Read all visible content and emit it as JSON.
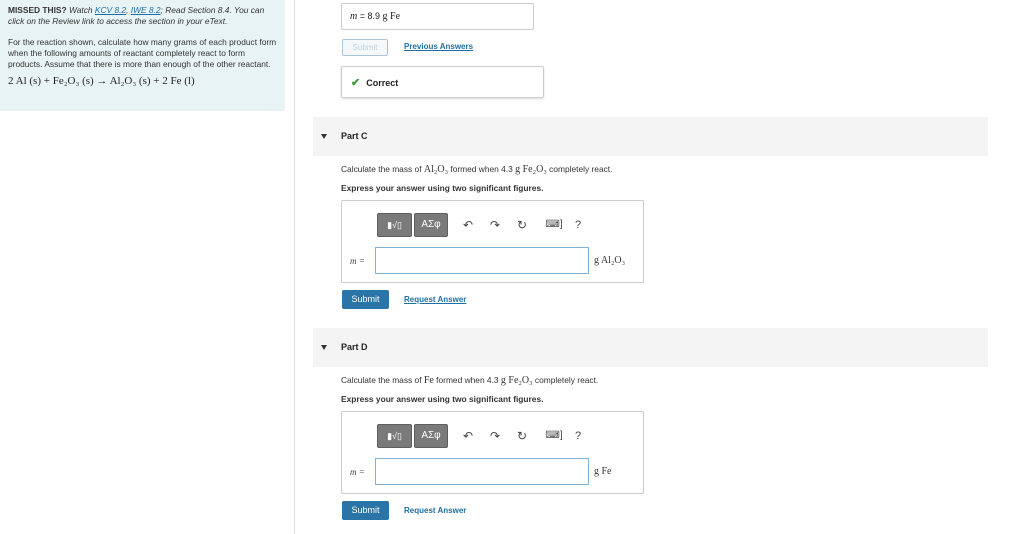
{
  "left": {
    "missed_label": "MISSED THIS?",
    "watch_text": "Watch",
    "link1": "KCV 8.2",
    "sep": ",",
    "link2": "IWE 8.2",
    "read_text": "; Read Section 8.4. You can click on the Review link to access the section in your eText.",
    "instructions": "For the reaction shown, calculate how many grams of each product form when the following amounts of reactant completely react to form products. Assume that there is more than enough of the other reactant.",
    "equation": "2 Al (s) + Fe₂O₃ (s) → Al₂O₃ (s) + 2 Fe (l)"
  },
  "prev_part": {
    "answer_var": "m",
    "answer_eq": " = ",
    "answer_value": "8.9",
    "answer_unit": "g Fe",
    "submit_label": "Submit",
    "previous_answers_label": "Previous Answers",
    "correct_label": "Correct"
  },
  "part_c": {
    "title": "Part C",
    "question_pre": "Calculate the mass of ",
    "question_compound": "Al₂O₃",
    "question_mid": " formed when 4.3 ",
    "question_reactant": "g Fe₂O₃",
    "question_post": " completely react.",
    "instruction": "Express your answer using two significant figures.",
    "var_label": "m =",
    "unit": "g Al₂O₃",
    "submit_label": "Submit",
    "request_label": "Request Answer"
  },
  "part_d": {
    "title": "Part D",
    "question_pre": "Calculate the mass of ",
    "question_compound": "Fe",
    "question_mid": " formed when 4.3 ",
    "question_reactant": "g Fe₂O₃",
    "question_post": " completely react.",
    "instruction": "Express your answer using two significant figures.",
    "var_label": "m =",
    "unit": "g Fe",
    "submit_label": "Submit",
    "request_label": "Request Answer"
  },
  "toolbar": {
    "templates_glyph": "▮√▯",
    "greek_glyph": "ΑΣφ",
    "undo_glyph": "↶",
    "redo_glyph": "↷",
    "reset_glyph": "↻",
    "keyboard_glyph": "⌨]",
    "help_glyph": "?"
  },
  "colors": {
    "accent": "#2a74a8",
    "panel": "#e8f3f6",
    "correct": "#3a9a3a"
  }
}
